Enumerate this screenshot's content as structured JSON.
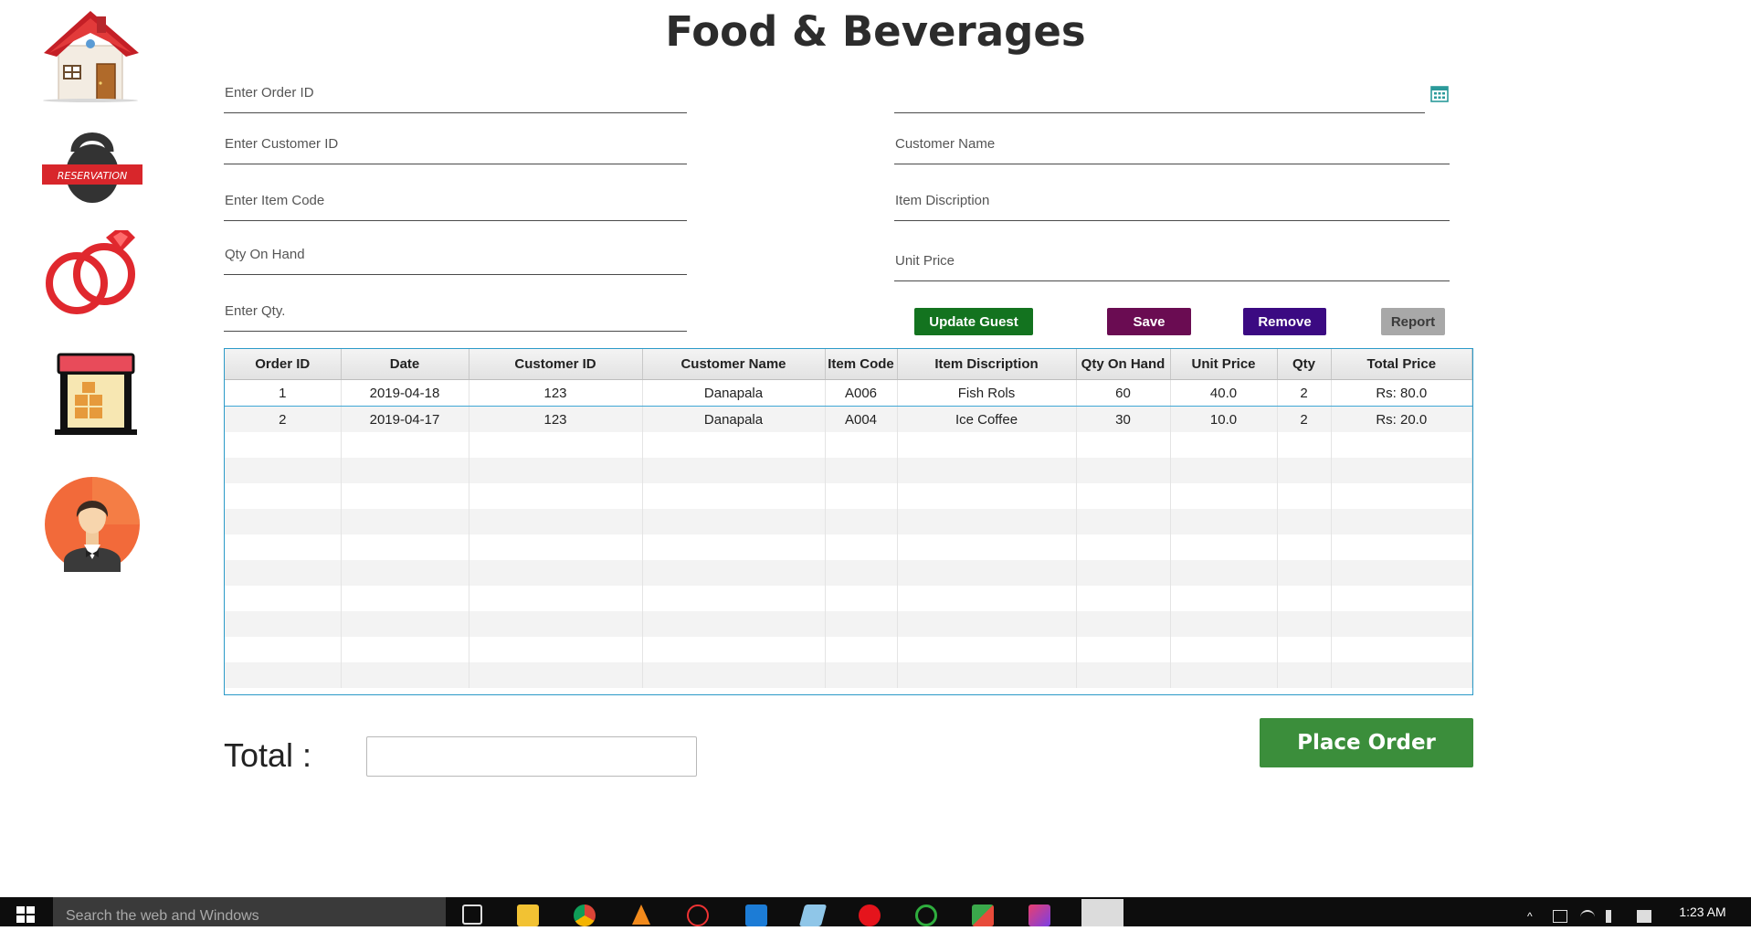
{
  "title": "Food & Beverages",
  "sidebar": {
    "items": [
      {
        "name": "home",
        "label": ""
      },
      {
        "name": "reservation",
        "label": "RESERVATION"
      },
      {
        "name": "wedding",
        "label": ""
      },
      {
        "name": "store",
        "label": ""
      },
      {
        "name": "waiter",
        "label": ""
      }
    ]
  },
  "form": {
    "order_id_placeholder": "Enter Order ID",
    "date_placeholder": "",
    "customer_id_placeholder": "Enter Customer ID",
    "customer_name_placeholder": "Customer Name",
    "item_code_placeholder": "Enter Item Code",
    "item_description_placeholder": "Item Discription",
    "qty_on_hand_placeholder": "Qty On Hand",
    "unit_price_placeholder": "Unit Price",
    "qty_placeholder": "Enter Qty."
  },
  "buttons": {
    "update_guest": "Update Guest",
    "save": "Save",
    "remove": "Remove",
    "report": "Report",
    "place_order": "Place Order"
  },
  "colors": {
    "update_guest": "#13731f",
    "save": "#6a0c52",
    "remove": "#3b0a82",
    "report": "#a8a8a8",
    "place_order": "#3b8e3b",
    "table_border": "#2b9ac8"
  },
  "table": {
    "columns": [
      "Order ID",
      "Date",
      "Customer ID",
      "Customer Name",
      "Item Code",
      "Item Discription",
      "Qty On Hand",
      "Unit Price",
      "Qty",
      "Total Price"
    ],
    "rows": [
      [
        "1",
        "2019-04-18",
        "123",
        "Danapala",
        "A006",
        "Fish Rols",
        "60",
        "40.0",
        "2",
        "Rs: 80.0"
      ],
      [
        "2",
        "2019-04-17",
        "123",
        "Danapala",
        "A004",
        "Ice Coffee",
        "30",
        "10.0",
        "2",
        "Rs: 20.0"
      ]
    ]
  },
  "total": {
    "label": "Total :",
    "value": ""
  },
  "taskbar": {
    "search_placeholder": "Search the web and Windows",
    "clock": "1:23 AM"
  }
}
